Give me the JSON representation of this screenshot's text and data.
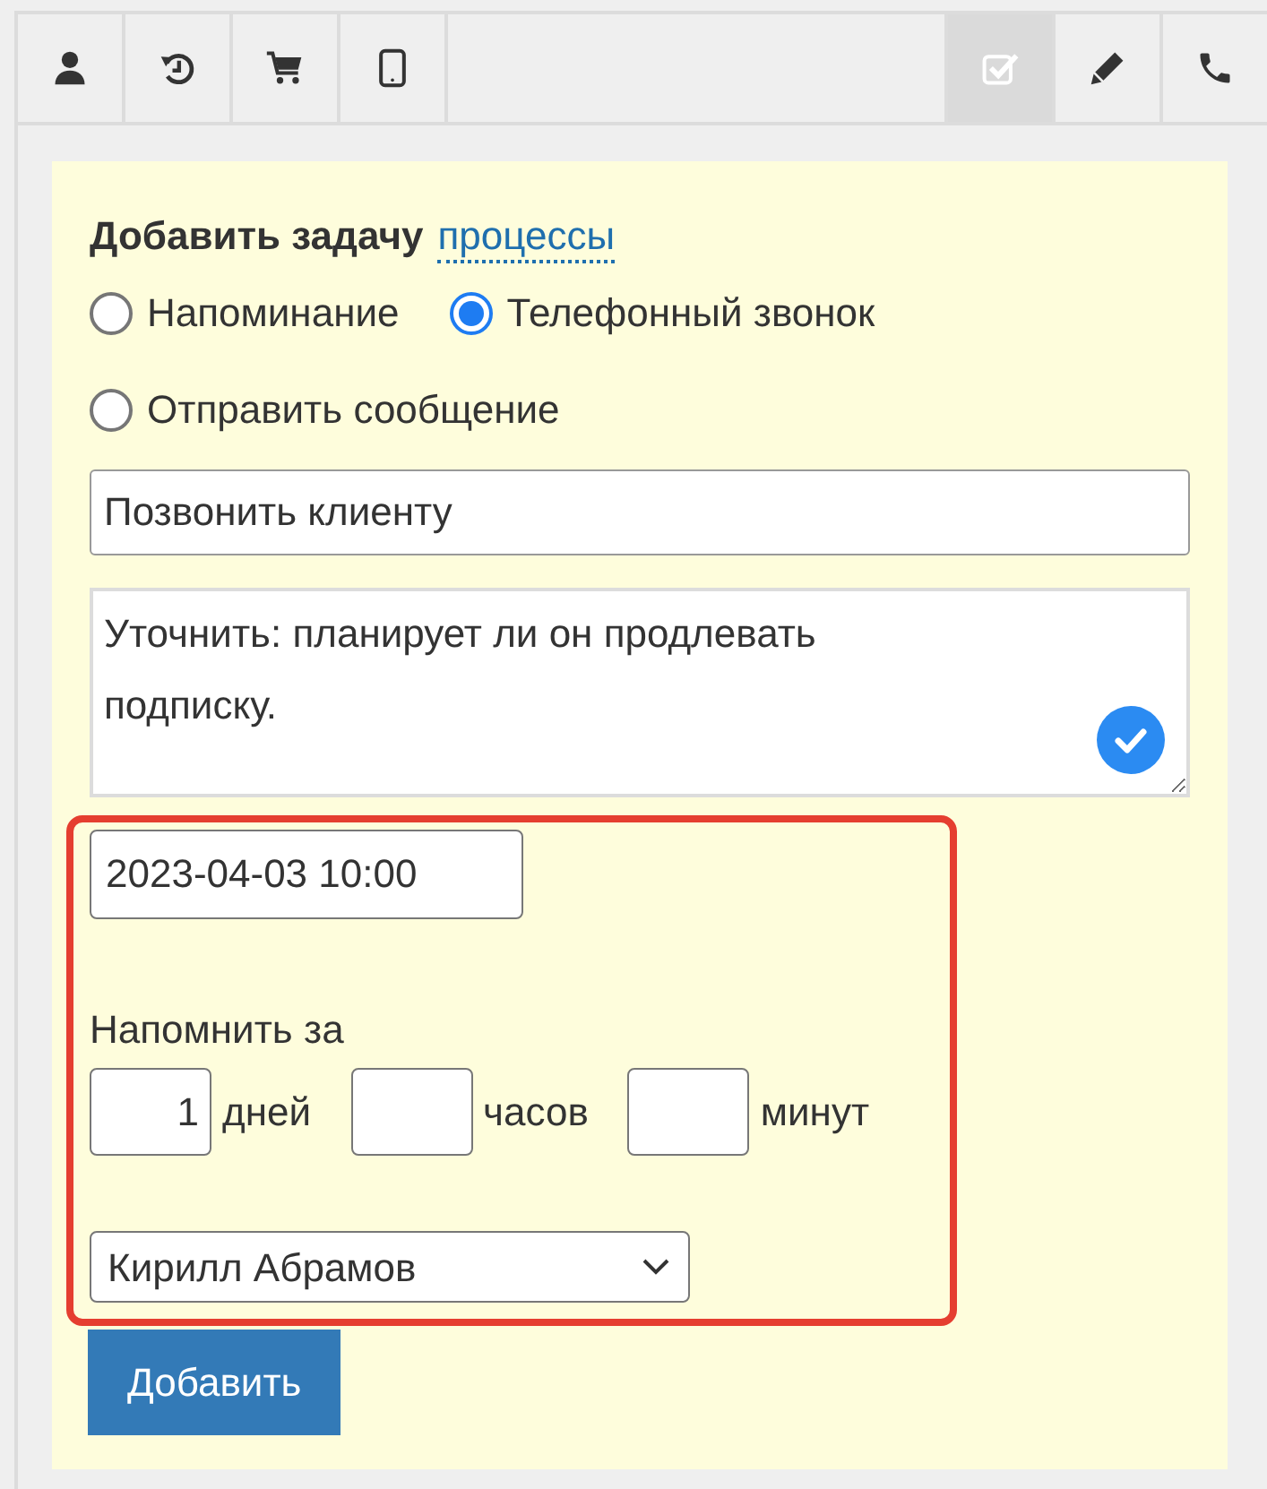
{
  "toolbar": {
    "left_tabs": [
      {
        "kind": "user",
        "selected": false
      },
      {
        "kind": "history",
        "selected": false
      },
      {
        "kind": "cart",
        "selected": false
      },
      {
        "kind": "tablet",
        "selected": false
      }
    ],
    "right_tabs": [
      {
        "kind": "tasks",
        "selected": true
      },
      {
        "kind": "edit",
        "selected": false
      },
      {
        "kind": "phone",
        "selected": false
      }
    ]
  },
  "form": {
    "title": "Добавить задачу",
    "title_link": "процессы",
    "task_types": [
      {
        "label": "Напоминание",
        "selected": false
      },
      {
        "label": "Телефонный звонок",
        "selected": true
      },
      {
        "label": "Отправить сообщение",
        "selected": false
      }
    ],
    "subject": {
      "value": "Позвонить клиенту"
    },
    "description": {
      "value": "Уточнить: планирует ли он продлевать подписку."
    },
    "reminder": {
      "highlighted": true,
      "due": {
        "value": "2023-04-03 10:00"
      },
      "label": "Напомнить за",
      "offsets": [
        {
          "value": "1",
          "unit": "дней"
        },
        {
          "unit": "часов"
        },
        {
          "unit": "минут"
        }
      ],
      "assignee": {
        "value": "Кирилл Абрамов"
      }
    },
    "submit": "Добавить"
  }
}
